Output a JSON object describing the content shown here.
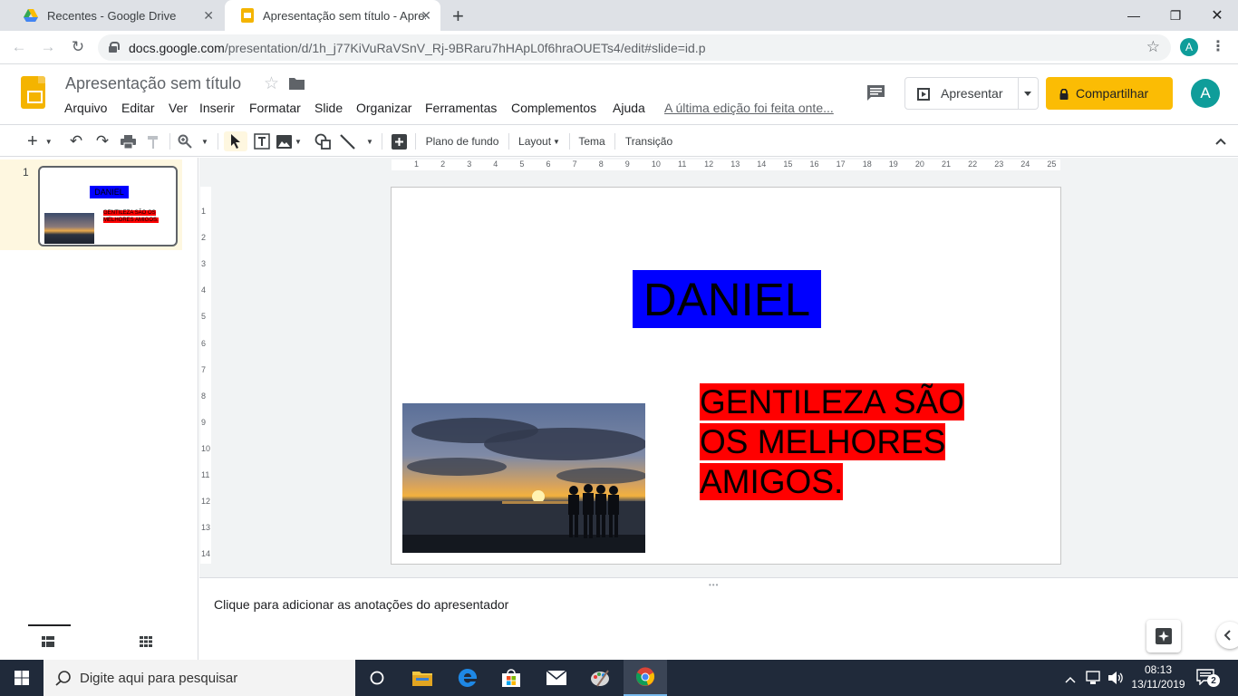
{
  "browser": {
    "tabs": [
      {
        "title": "Recentes - Google Drive",
        "icon": "google-drive-icon",
        "active": false
      },
      {
        "title": "Apresentação sem título - Apres",
        "icon": "google-slides-icon",
        "active": true
      }
    ],
    "new_tab_symbol": "+",
    "url_host": "docs.google.com",
    "url_path": "/presentation/d/1h_j77KiVuRaVSnV_Rj-9BRaru7hHApL0f6hraOUETs4/edit#slide=id.p",
    "profile_initial": "A"
  },
  "app": {
    "doc_title": "Apresentação sem título",
    "menus": [
      "Arquivo",
      "Editar",
      "Ver",
      "Inserir",
      "Formatar",
      "Slide",
      "Organizar",
      "Ferramentas",
      "Complementos",
      "Ajuda"
    ],
    "last_edit": "A última edição foi feita onte...",
    "present_label": "Apresentar",
    "share_label": "Compartilhar",
    "avatar_initial": "A",
    "accent_color": "#fbbc04"
  },
  "toolbar": {
    "background_label": "Plano de fundo",
    "layout_label": "Layout",
    "theme_label": "Tema",
    "transition_label": "Transição"
  },
  "filmstrip": {
    "slide_number": "1"
  },
  "rulers": {
    "horizontal": [
      "1",
      "2",
      "3",
      "4",
      "5",
      "6",
      "7",
      "8",
      "9",
      "10",
      "11",
      "12",
      "13",
      "14",
      "15",
      "16",
      "17",
      "18",
      "19",
      "20",
      "21",
      "22",
      "23",
      "24",
      "25"
    ],
    "vertical": [
      "1",
      "2",
      "3",
      "4",
      "5",
      "6",
      "7",
      "8",
      "9",
      "10",
      "11",
      "12",
      "13",
      "14"
    ]
  },
  "slide": {
    "title": "DANIEL",
    "title_bg": "#0000ff",
    "body": "GENTILEZA SÃO OS MELHORES AMIGOS.",
    "body_bg": "#ff0000"
  },
  "notes": {
    "placeholder": "Clique para adicionar as anotações do apresentador"
  },
  "taskbar": {
    "search_placeholder": "Digite aqui para pesquisar",
    "time": "08:13",
    "date": "13/11/2019",
    "notification_count": "2"
  }
}
